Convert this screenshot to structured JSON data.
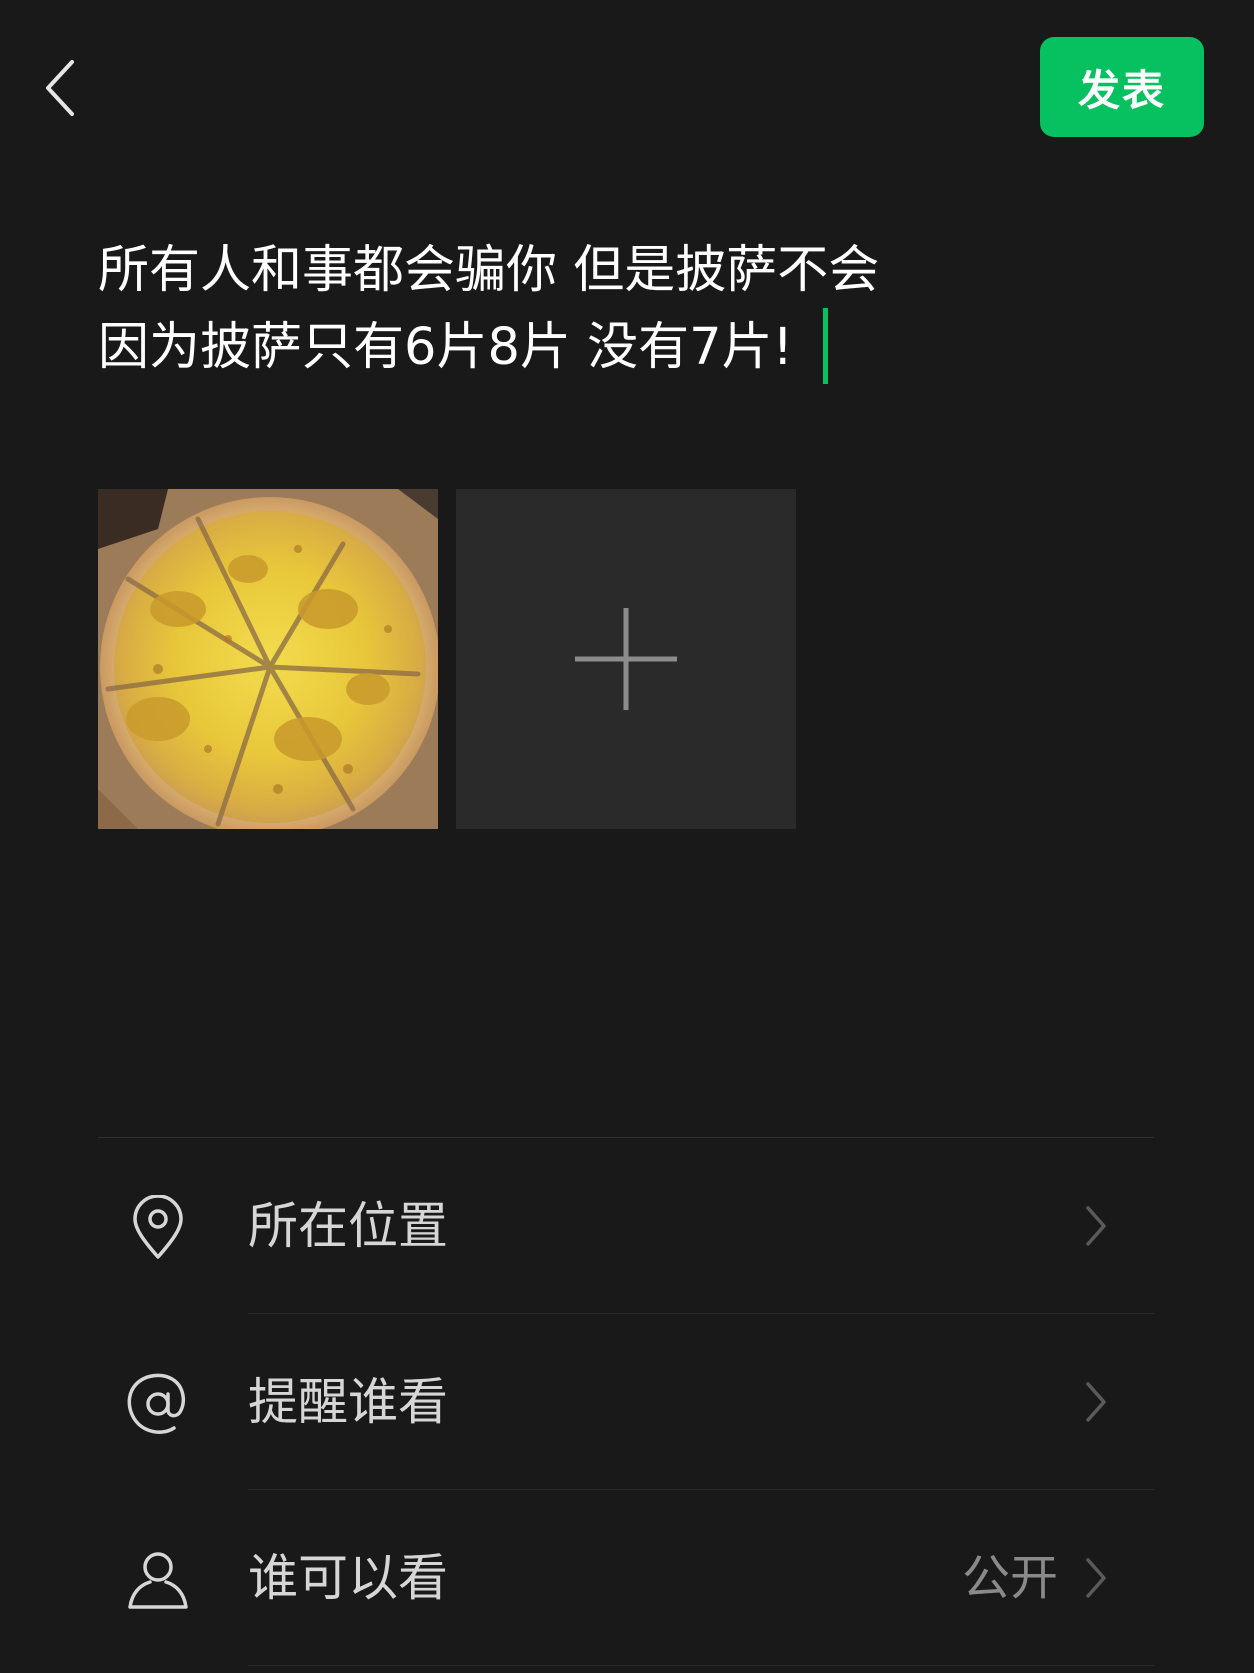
{
  "header": {
    "publish_label": "发表"
  },
  "post": {
    "line1": "所有人和事都会骗你 但是披萨不会",
    "line2": "因为披萨只有6片8片 没有7片!"
  },
  "options": [
    {
      "label": "所在位置",
      "value": "",
      "icon": "location-pin-icon"
    },
    {
      "label": "提醒谁看",
      "value": "",
      "icon": "at-sign-icon"
    },
    {
      "label": "谁可以看",
      "value": "公开",
      "icon": "person-icon"
    }
  ],
  "colors": {
    "accent": "#07c160",
    "background": "#191919",
    "tile": "#2a2a2a"
  }
}
